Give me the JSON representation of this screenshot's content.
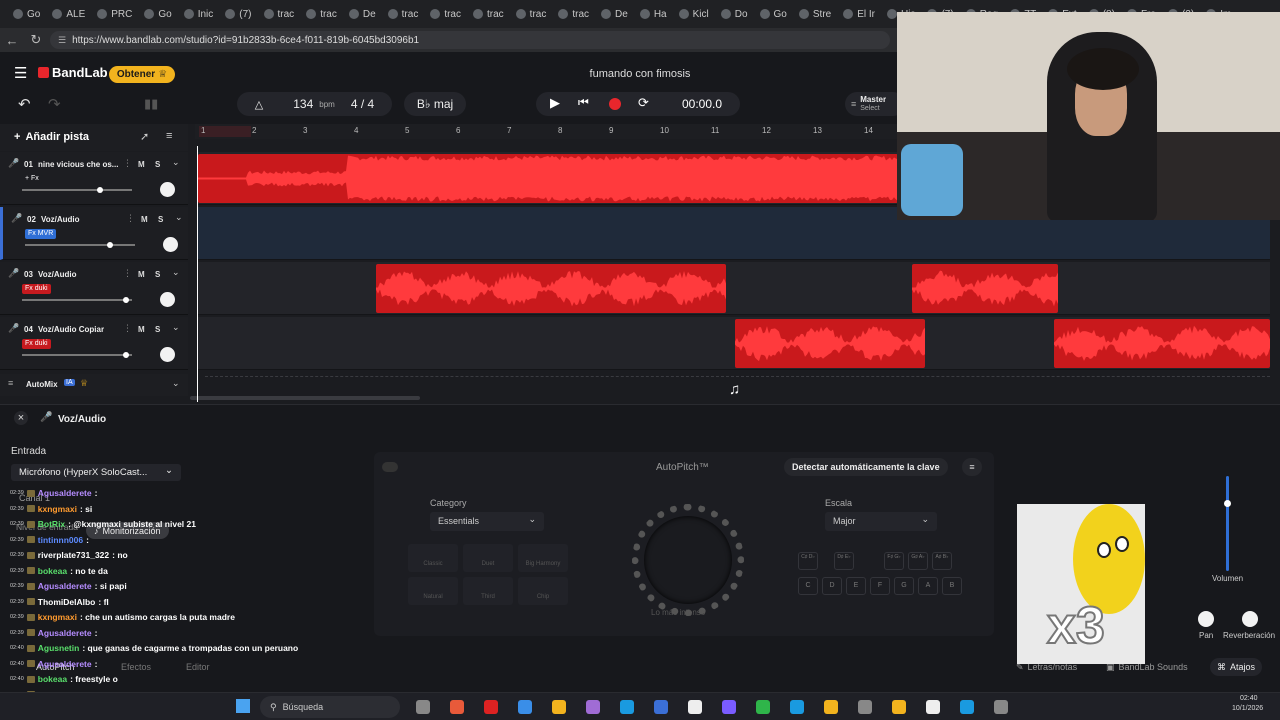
{
  "browser": {
    "tabs": [
      "Go",
      "ALE",
      "PRC",
      "Go",
      "Inic",
      "(7)",
      "trac",
      "trac",
      "De",
      "trac",
      "trac",
      "trac",
      "trac",
      "trac",
      "De",
      "Ha",
      "Kicl",
      "Do",
      "Go",
      "Stre",
      "El Ir",
      "His",
      "(7)",
      "Rag",
      "ZT",
      "Ext",
      "(8)",
      "Fra",
      "(2)",
      "Im"
    ],
    "url": "https://www.bandlab.com/studio?id=91b2833b-6ce4-f011-819b-6045bd3096b1"
  },
  "header": {
    "brand": "BandLab",
    "obtener_label": "Obtener",
    "project_title": "fumando con fimosis",
    "master_label": "Master",
    "master_sub": "Select"
  },
  "transport": {
    "tempo": "134",
    "tempo_unit": "bpm",
    "time_signature": "4 / 4",
    "key": "B♭ maj",
    "time": "00:00.0"
  },
  "tracks_panel": {
    "add_track_label": "Añadir pista",
    "ruler": [
      "1",
      "2",
      "3",
      "4",
      "5",
      "6",
      "7",
      "8",
      "9",
      "10",
      "11",
      "12",
      "13",
      "14"
    ],
    "tracks": [
      {
        "num": "01",
        "name": "nine vicious che os...",
        "fx": "+ Fx",
        "fx_color": "#1d1e22",
        "color": "#c61a1f"
      },
      {
        "num": "02",
        "name": "Voz/Audio",
        "fx": "Fx MVR",
        "fx_color": "#2f6fd6",
        "color": "#3b6fd6"
      },
      {
        "num": "03",
        "name": "Voz/Audio",
        "fx": "Fx duki",
        "fx_color": "#c61a1f",
        "color": "#c61a1f"
      },
      {
        "num": "04",
        "name": "Voz/Audio Copiar",
        "fx": "Fx duki",
        "fx_color": "#c61a1f",
        "color": "#c61a1f"
      }
    ],
    "mute_label": "M",
    "solo_label": "S",
    "automix_label": "AutoMix",
    "automix_badge": "IA"
  },
  "bottom_panel": {
    "track_title": "Voz/Audio",
    "entrada_label": "Entrada",
    "mic_select": "Micrófono (HyperX SoloCast...",
    "canal_label": "Canal 1",
    "nivel_label": "Nivel de entrada",
    "monitor_label": "Monitorización",
    "autopitch_title": "AutoPitch™",
    "detect_key_label": "Detectar automáticamente la clave",
    "category_label": "Category",
    "category_value": "Essentials",
    "escala_label": "Escala",
    "escala_value": "Major",
    "knob_caption": "Lo más intenso",
    "modes": [
      "Classic",
      "Duet",
      "Big Harmony",
      "Natural",
      "Third",
      "Chip"
    ],
    "keys_top": [
      "C♯ D♭",
      "D♯ E♭",
      "F♯ G♭",
      "G♯ A♭",
      "A♯ B♭"
    ],
    "keys_bottom": [
      "C",
      "D",
      "E",
      "F",
      "G",
      "A",
      "B"
    ],
    "volumen_label": "Volumen",
    "pan_label": "Pan",
    "reverb_label": "Reverberación",
    "tabs": [
      "Efectos",
      "Editor"
    ],
    "autopitch_tab": "AutoPitch",
    "bottom_links": [
      "Letras/notas",
      "BandLab Sounds",
      "Atajos"
    ]
  },
  "chat": [
    {
      "time": "02:39",
      "user": "Agusalderete",
      "color": "#b58cff",
      "msg": ":"
    },
    {
      "time": "02:39",
      "user": "kxngmaxi",
      "color": "#ff9b2f",
      "msg": ": si"
    },
    {
      "time": "02:39",
      "user": "BotRix",
      "color": "#5adf6c",
      "msg": ": @kxngmaxi subiste al nivel 21"
    },
    {
      "time": "02:39",
      "user": "tintinnn006",
      "color": "#5d8bff",
      "msg": ":"
    },
    {
      "time": "02:39",
      "user": "riverplate731_322",
      "color": "#ffffff",
      "msg": ": no"
    },
    {
      "time": "02:39",
      "user": "bokeaa",
      "color": "#5adf6c",
      "msg": ": no te da"
    },
    {
      "time": "02:39",
      "user": "Agusalderete",
      "color": "#b58cff",
      "msg": ": si papi"
    },
    {
      "time": "02:39",
      "user": "ThomiDelAlbo",
      "color": "#ffffff",
      "msg": ": fl"
    },
    {
      "time": "02:39",
      "user": "kxngmaxi",
      "color": "#ff9b2f",
      "msg": ": che un autismo cargas la puta madre"
    },
    {
      "time": "02:39",
      "user": "Agusalderete",
      "color": "#b58cff",
      "msg": ":"
    },
    {
      "time": "02:40",
      "user": "Agusnetin",
      "color": "#5adf6c",
      "msg": ": que ganas de cagarme a trompadas con un peruano"
    },
    {
      "time": "02:40",
      "user": "Agusalderete",
      "color": "#b58cff",
      "msg": ":"
    },
    {
      "time": "02:40",
      "user": "bokeaa",
      "color": "#5adf6c",
      "msg": ": freestyle o"
    },
    {
      "time": "02:40",
      "user": "Agusalderete",
      "color": "#b58cff",
      "msg": ":"
    },
    {
      "time": "02:40",
      "user": "Agusalderete",
      "color": "#b58cff",
      "msg": ":"
    }
  ],
  "taskbar": {
    "search_label": "Búsqueda",
    "clock_time": "02:40",
    "clock_date": "10/1/2026"
  },
  "meme_overlay": {
    "text": "x3"
  }
}
